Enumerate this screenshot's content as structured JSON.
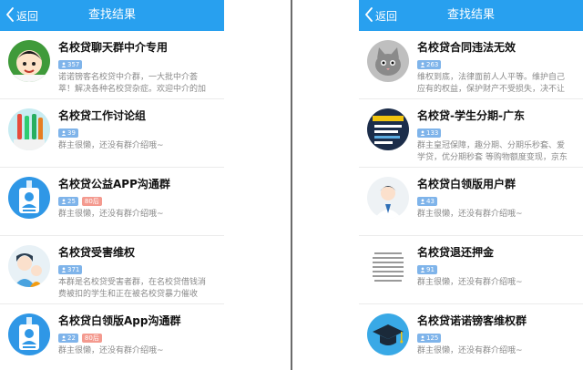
{
  "screens": [
    {
      "nav": {
        "back_label": "返回",
        "title": "查找结果"
      },
      "results": [
        {
          "name": "名校贷聊天群中介专用",
          "members": "357",
          "extra_tag": "",
          "desc": "诺诺镑客名校贷中介群，一大批中介荟萃！解决各种名校贷杂症。欢迎中介的加",
          "avatar": "cartoon-boy-avatar"
        },
        {
          "name": "名校贷工作讨论组",
          "members": "39",
          "extra_tag": "",
          "desc": "群主很懒，还没有群介绍哦~",
          "avatar": "toothbrush-avatar"
        },
        {
          "name": "名校贷公益APP沟通群",
          "members": "25",
          "extra_tag": "80后",
          "desc": "群主很懒，还没有群介绍哦~",
          "avatar": "id-badge-avatar"
        },
        {
          "name": "名校贷受害维权",
          "members": "371",
          "extra_tag": "",
          "desc": "本群是名校贷受害者群，在名校贷借钱消费被扣的学生和正在被名校贷暴力催收",
          "avatar": "family-avatar"
        },
        {
          "name": "名校贷白领版App沟通群",
          "members": "22",
          "extra_tag": "80后",
          "desc": "群主很懒，还没有群介绍哦~",
          "avatar": "id-badge-avatar"
        }
      ]
    },
    {
      "nav": {
        "back_label": "返回",
        "title": "查找结果"
      },
      "results": [
        {
          "name": "名校贷合同违法无效",
          "members": "263",
          "extra_tag": "",
          "desc": "维权到底，法律面前人人平等。维护自己应有的权益，保护财产不受损失，决不让",
          "avatar": "cat-photo-avatar"
        },
        {
          "name": "名校贷-学生分期-广东",
          "members": "133",
          "extra_tag": "",
          "desc": "群主皇冠保障，趣分期、分期乐秒套、爱学贷，优分期秒套 等购物额度变现，京东",
          "avatar": "ad-poster-avatar"
        },
        {
          "name": "名校贷白领版用户群",
          "members": "43",
          "extra_tag": "",
          "desc": "群主很懒，还没有群介绍哦~",
          "avatar": "businessman-avatar"
        },
        {
          "name": "名校贷退还押金",
          "members": "91",
          "extra_tag": "",
          "desc": "群主很懒，还没有群介绍哦~",
          "avatar": "text-document-avatar"
        },
        {
          "name": "名校贷诺诺镑客维权群",
          "members": "125",
          "extra_tag": "",
          "desc": "群主很懒，还没有群介绍哦~",
          "avatar": "graduation-cap-avatar"
        }
      ]
    }
  ],
  "colors": {
    "navbar": "#28a0ef",
    "member_tag": "#7fb4ea",
    "extra_tag": "#f49a8f"
  },
  "icons": {
    "back": "chevron-left-icon",
    "member_count": "person-icon"
  }
}
